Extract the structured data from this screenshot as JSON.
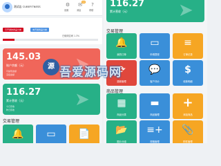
{
  "left": {
    "header": {
      "store_name": "测试店 CUBEFITNESS",
      "settings_label": "设置",
      "messages_label": "消息",
      "messages_badge": "88",
      "help_label": "帮助"
    },
    "chips": [
      {
        "text": "已开通的商品分类",
        "color": "#d0021b"
      },
      {
        "text": "未开通商品分类",
        "color": "#4a90e2"
      }
    ],
    "progress_text": "已使用空间 1.3%",
    "progress_value": 0.12,
    "cards": [
      {
        "value": "145.03",
        "caption": "账户余额（元）",
        "sub_left": "可提现金额",
        "sub_right": "冻结金额",
        "color": "#f0665a"
      },
      {
        "value": "116.27",
        "caption": "累计营收（元）",
        "sub_left": "今日营收",
        "sub_right": "昨日营收",
        "color": "#27b087"
      }
    ],
    "section_title": "交易管理",
    "tiles": [
      {
        "icon": "bell-icon",
        "glyph": "🔔",
        "label": "",
        "color": "#27b087"
      },
      {
        "icon": "card-icon",
        "glyph": "▭",
        "label": "",
        "color": "#3a8fd9"
      },
      {
        "icon": "file-icon",
        "glyph": "📄",
        "label": "",
        "color": "#f6a623"
      }
    ]
  },
  "right": {
    "card": {
      "value": "116.27",
      "caption": "累计营收（元）",
      "color": "#27b087"
    },
    "sections": [
      {
        "title": "交易管理",
        "tiles": [
          {
            "icon": "bell-icon",
            "glyph": "🔔",
            "label": "我的订单",
            "color": "#27b087"
          },
          {
            "icon": "card-icon",
            "glyph": "▭",
            "label": "申请提现",
            "color": "#3a8fd9"
          },
          {
            "icon": "file-icon",
            "glyph": "≡",
            "label": "订单记录",
            "color": "#f6a623"
          },
          {
            "icon": "refresh-icon",
            "glyph": "⟳",
            "label": "退款管理",
            "color": "#e0473c"
          },
          {
            "icon": "chat-icon",
            "glyph": "💬",
            "label": "客户评价",
            "color": "#3a8fd9"
          },
          {
            "icon": "dollar-icon",
            "glyph": "$",
            "label": "收款明细",
            "color": "#3a8fd9"
          }
        ]
      },
      {
        "title": "商品管理",
        "tiles": [
          {
            "icon": "grid-icon",
            "glyph": "▦",
            "label": "商品分类",
            "color": "#27b087"
          },
          {
            "icon": "box-icon",
            "glyph": "▬",
            "label": "商品管理",
            "color": "#3a8fd9"
          },
          {
            "icon": "plus-icon",
            "glyph": "+",
            "label": "添加商品",
            "color": "#f6a623"
          },
          {
            "icon": "folder-icon",
            "glyph": "📂",
            "label": "图片分组",
            "color": "#27b087"
          },
          {
            "icon": "list-add-icon",
            "glyph": "≡+",
            "label": "规格管理",
            "color": "#3a8fd9"
          },
          {
            "icon": "clip-icon",
            "glyph": "📎",
            "label": "附件管理",
            "color": "#f6a623"
          }
        ]
      }
    ]
  },
  "watermark": {
    "text": "吾爱源码网",
    "logo": "源"
  }
}
